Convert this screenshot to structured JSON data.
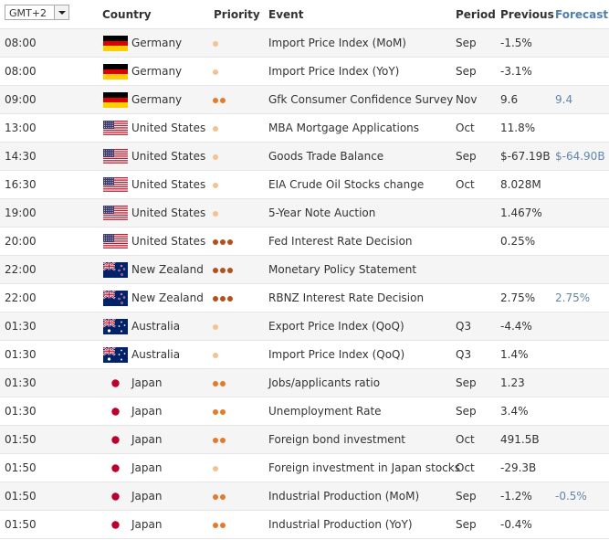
{
  "timezone": {
    "value": "GMT+2"
  },
  "headers": {
    "country": "Country",
    "priority": "Priority",
    "event": "Event",
    "period": "Period",
    "previous": "Previous",
    "forecast": "Forecast"
  },
  "rows": [
    {
      "time": "08:00",
      "flag": "germany",
      "country": "Germany",
      "priority": 1,
      "event": "Import Price Index (MoM)",
      "period": "Sep",
      "previous": "-1.5%",
      "forecast": ""
    },
    {
      "time": "08:00",
      "flag": "germany",
      "country": "Germany",
      "priority": 1,
      "event": "Import Price Index (YoY)",
      "period": "Sep",
      "previous": "-3.1%",
      "forecast": ""
    },
    {
      "time": "09:00",
      "flag": "germany",
      "country": "Germany",
      "priority": 2,
      "event": "Gfk Consumer Confidence Survey",
      "period": "Nov",
      "previous": "9.6",
      "forecast": "9.4"
    },
    {
      "time": "13:00",
      "flag": "us",
      "country": "United States",
      "priority": 1,
      "event": "MBA Mortgage Applications",
      "period": "Oct",
      "previous": "11.8%",
      "forecast": ""
    },
    {
      "time": "14:30",
      "flag": "us",
      "country": "United States",
      "priority": 1,
      "event": "Goods Trade Balance",
      "period": "Sep",
      "previous": "$-67.19B",
      "forecast": "$-64.90B"
    },
    {
      "time": "16:30",
      "flag": "us",
      "country": "United States",
      "priority": 1,
      "event": "EIA Crude Oil Stocks change",
      "period": "Oct",
      "previous": "8.028M",
      "forecast": ""
    },
    {
      "time": "19:00",
      "flag": "us",
      "country": "United States",
      "priority": 1,
      "event": "5-Year Note Auction",
      "period": "",
      "previous": "1.467%",
      "forecast": ""
    },
    {
      "time": "20:00",
      "flag": "us",
      "country": "United States",
      "priority": 3,
      "event": "Fed Interest Rate Decision",
      "period": "",
      "previous": "0.25%",
      "forecast": ""
    },
    {
      "time": "22:00",
      "flag": "nz",
      "country": "New Zealand",
      "priority": 3,
      "event": "Monetary Policy Statement",
      "period": "",
      "previous": "",
      "forecast": ""
    },
    {
      "time": "22:00",
      "flag": "nz",
      "country": "New Zealand",
      "priority": 3,
      "event": "RBNZ Interest Rate Decision",
      "period": "",
      "previous": "2.75%",
      "forecast": "2.75%"
    },
    {
      "time": "01:30",
      "flag": "au",
      "country": "Australia",
      "priority": 1,
      "event": "Export Price Index (QoQ)",
      "period": "Q3",
      "previous": "-4.4%",
      "forecast": ""
    },
    {
      "time": "01:30",
      "flag": "au",
      "country": "Australia",
      "priority": 1,
      "event": "Import Price Index (QoQ)",
      "period": "Q3",
      "previous": "1.4%",
      "forecast": ""
    },
    {
      "time": "01:30",
      "flag": "jp",
      "country": "Japan",
      "priority": 2,
      "event": "Jobs/applicants ratio",
      "period": "Sep",
      "previous": "1.23",
      "forecast": ""
    },
    {
      "time": "01:30",
      "flag": "jp",
      "country": "Japan",
      "priority": 2,
      "event": "Unemployment Rate",
      "period": "Sep",
      "previous": "3.4%",
      "forecast": ""
    },
    {
      "time": "01:50",
      "flag": "jp",
      "country": "Japan",
      "priority": 2,
      "event": "Foreign bond investment",
      "period": "Oct",
      "previous": "491.5B",
      "forecast": ""
    },
    {
      "time": "01:50",
      "flag": "jp",
      "country": "Japan",
      "priority": 1,
      "event": "Foreign investment in Japan stocks",
      "period": "Oct",
      "previous": "-29.3B",
      "forecast": ""
    },
    {
      "time": "01:50",
      "flag": "jp",
      "country": "Japan",
      "priority": 2,
      "event": "Industrial Production (MoM)",
      "period": "Sep",
      "previous": "-1.2%",
      "forecast": "-0.5%"
    },
    {
      "time": "01:50",
      "flag": "jp",
      "country": "Japan",
      "priority": 2,
      "event": "Industrial Production (YoY)",
      "period": "Sep",
      "previous": "-0.4%",
      "forecast": ""
    }
  ],
  "colors": {
    "forecast_header": "#4f7fae",
    "forecast_value": "#6286ad",
    "row_alt": "#f5f5f5",
    "priority_low": "#f5c18f",
    "priority_medium": "#e57a2a",
    "priority_high": "#b4501a"
  }
}
